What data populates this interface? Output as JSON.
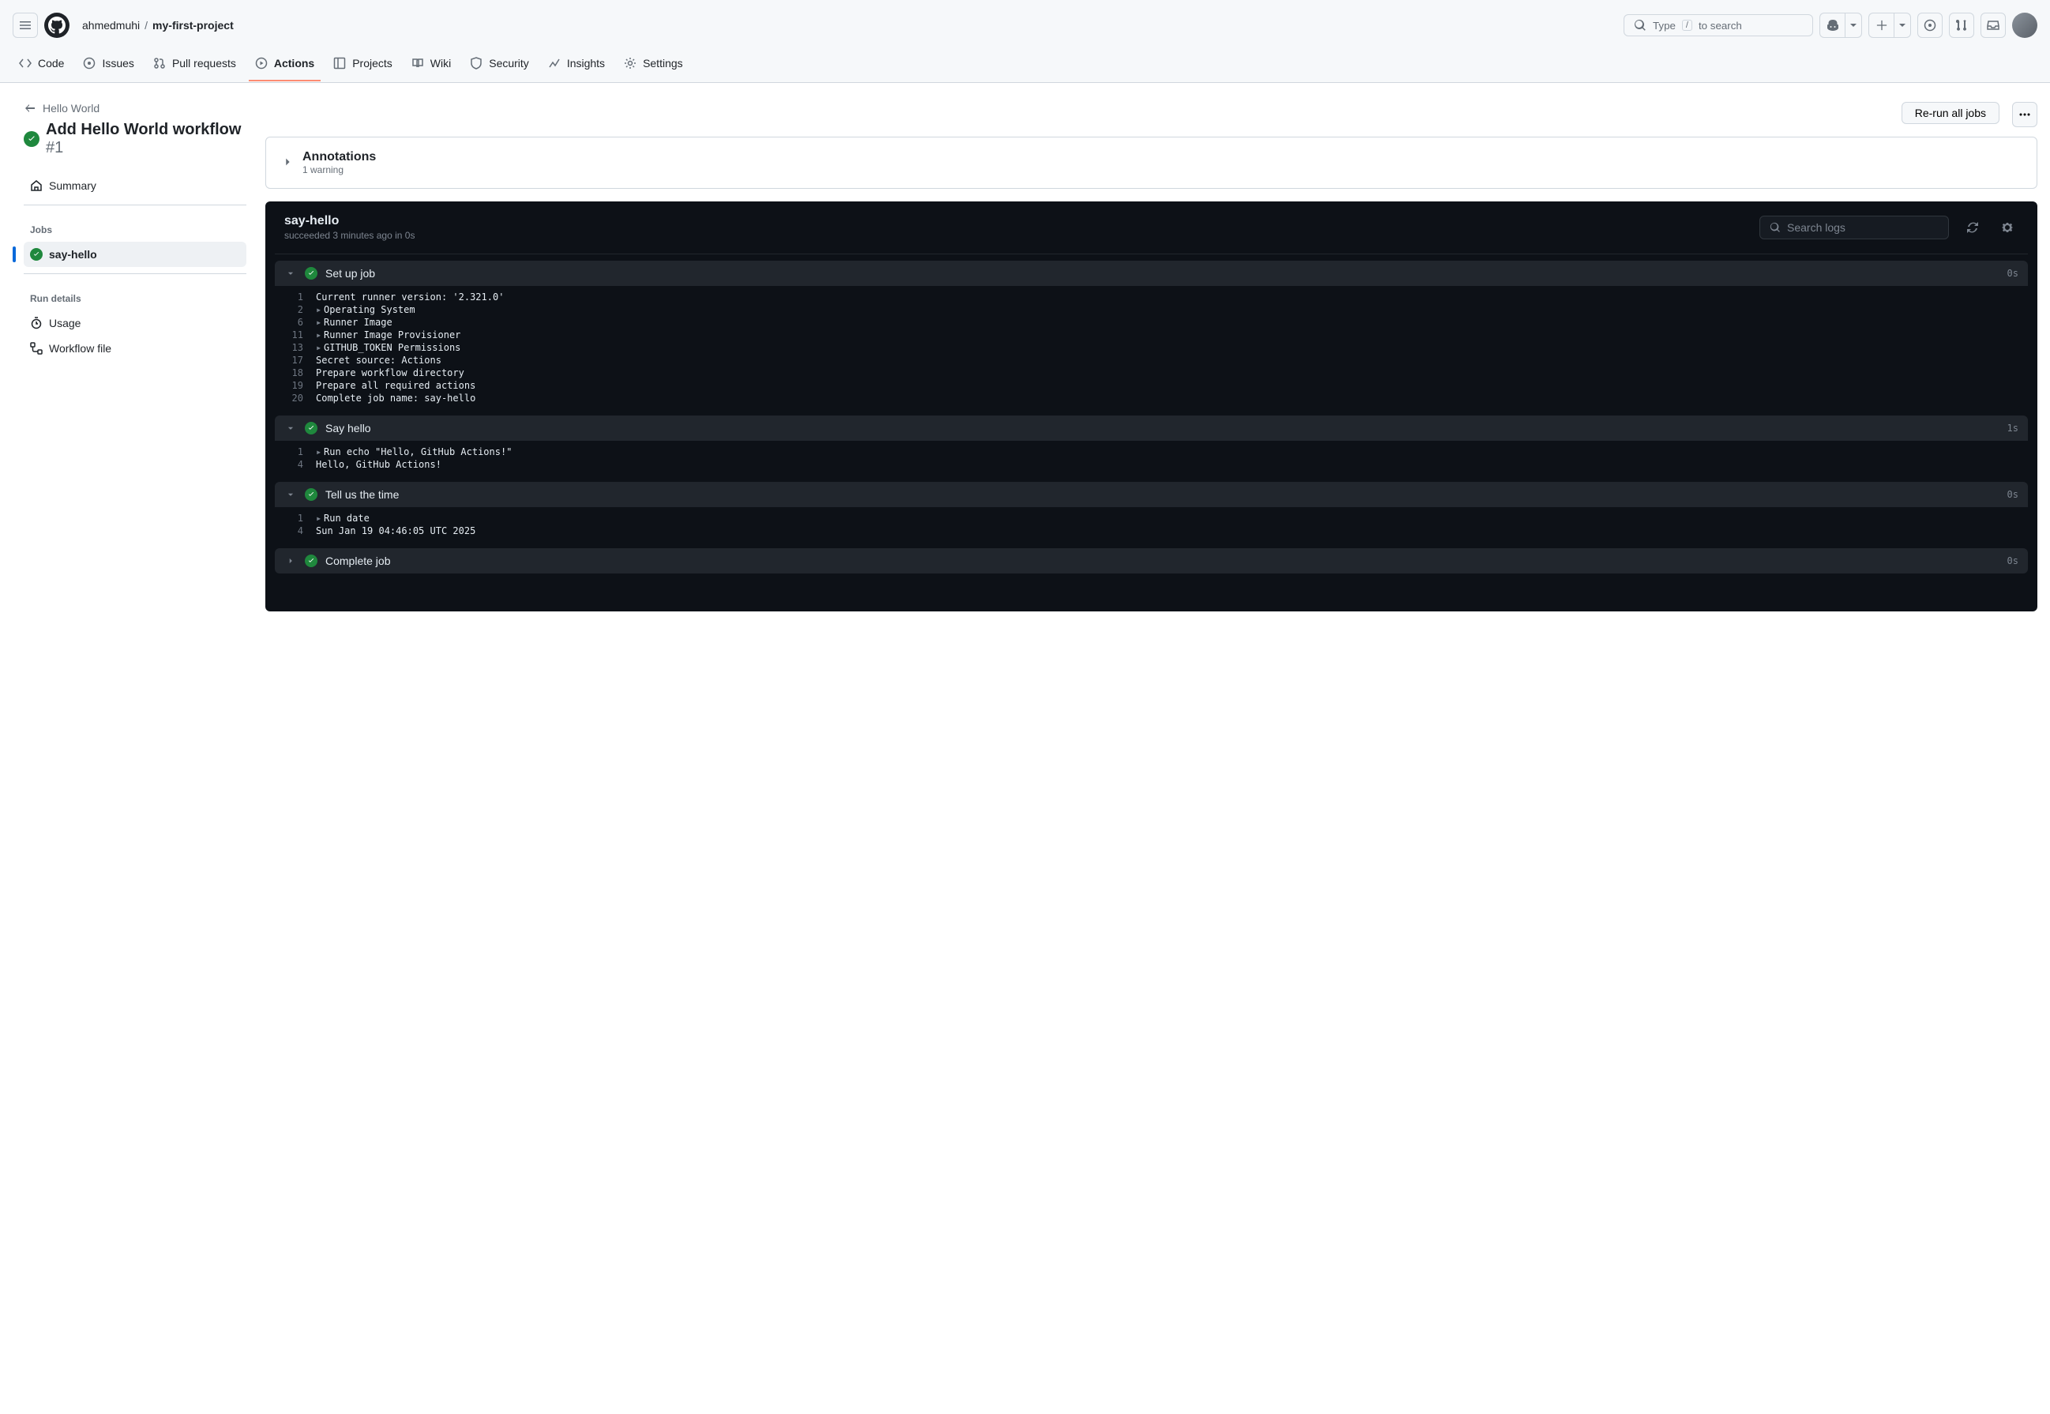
{
  "header": {
    "owner": "ahmedmuhi",
    "repo": "my-first-project",
    "search_label": "Type",
    "search_kbd": "/",
    "search_suffix": "to search"
  },
  "repo_nav": [
    {
      "id": "code",
      "label": "Code"
    },
    {
      "id": "issues",
      "label": "Issues"
    },
    {
      "id": "pulls",
      "label": "Pull requests"
    },
    {
      "id": "actions",
      "label": "Actions",
      "active": true
    },
    {
      "id": "projects",
      "label": "Projects"
    },
    {
      "id": "wiki",
      "label": "Wiki"
    },
    {
      "id": "security",
      "label": "Security"
    },
    {
      "id": "insights",
      "label": "Insights"
    },
    {
      "id": "settings",
      "label": "Settings"
    }
  ],
  "run": {
    "workflow_name": "Hello World",
    "title": "Add Hello World workflow",
    "number": "#1",
    "rerun_label": "Re-run all jobs"
  },
  "sidebar": {
    "summary": "Summary",
    "jobs_heading": "Jobs",
    "job_name": "say-hello",
    "details_heading": "Run details",
    "usage": "Usage",
    "workflow_file": "Workflow file"
  },
  "annotations": {
    "title": "Annotations",
    "subtitle": "1 warning"
  },
  "job_panel": {
    "name": "say-hello",
    "meta": "succeeded 3 minutes ago in 0s",
    "search_placeholder": "Search logs"
  },
  "steps": [
    {
      "name": "Set up job",
      "time": "0s",
      "expanded": true,
      "lines": [
        {
          "n": "1",
          "fold": false,
          "text": "Current runner version: '2.321.0'"
        },
        {
          "n": "2",
          "fold": true,
          "text": "Operating System"
        },
        {
          "n": "6",
          "fold": true,
          "text": "Runner Image"
        },
        {
          "n": "11",
          "fold": true,
          "text": "Runner Image Provisioner"
        },
        {
          "n": "13",
          "fold": true,
          "text": "GITHUB_TOKEN Permissions"
        },
        {
          "n": "17",
          "fold": false,
          "text": "Secret source: Actions"
        },
        {
          "n": "18",
          "fold": false,
          "text": "Prepare workflow directory"
        },
        {
          "n": "19",
          "fold": false,
          "text": "Prepare all required actions"
        },
        {
          "n": "20",
          "fold": false,
          "text": "Complete job name: say-hello"
        }
      ]
    },
    {
      "name": "Say hello",
      "time": "1s",
      "expanded": true,
      "lines": [
        {
          "n": "1",
          "fold": true,
          "text": "Run echo \"Hello, GitHub Actions!\""
        },
        {
          "n": "4",
          "fold": false,
          "text": "Hello, GitHub Actions!"
        }
      ]
    },
    {
      "name": "Tell us the time",
      "time": "0s",
      "expanded": true,
      "lines": [
        {
          "n": "1",
          "fold": true,
          "text": "Run date"
        },
        {
          "n": "4",
          "fold": false,
          "text": "Sun Jan 19 04:46:05 UTC 2025"
        }
      ]
    },
    {
      "name": "Complete job",
      "time": "0s",
      "expanded": false,
      "lines": []
    }
  ]
}
